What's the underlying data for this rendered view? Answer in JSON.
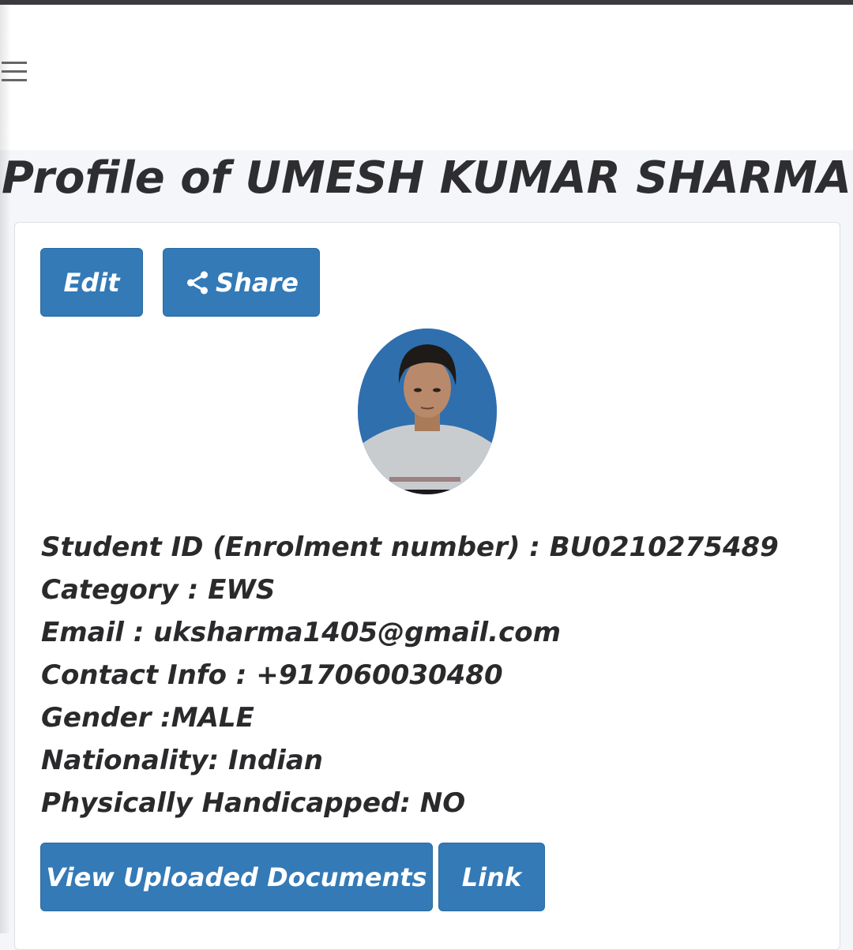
{
  "page": {
    "title": "Profile of UMESH KUMAR SHARMA"
  },
  "nav": {
    "menu_icon": "hamburger-menu-icon"
  },
  "actions": {
    "edit_label": "Edit",
    "share_label": "Share",
    "share_icon": "share-icon"
  },
  "profile": {
    "rows": [
      "Student ID (Enrolment number) : BU0210275489",
      "Category : EWS",
      "Email : uksharma1405@gmail.com",
      "Contact Info : +917060030480",
      "Gender :MALE",
      "Nationality: Indian",
      "Physically Handicapped: NO"
    ]
  },
  "footer_actions": {
    "view_docs_label": "View Uploaded Documents",
    "link_label": "Link"
  },
  "colors": {
    "primary": "#337ab7",
    "text": "#2a2a2c",
    "background": "#f4f6fa"
  }
}
